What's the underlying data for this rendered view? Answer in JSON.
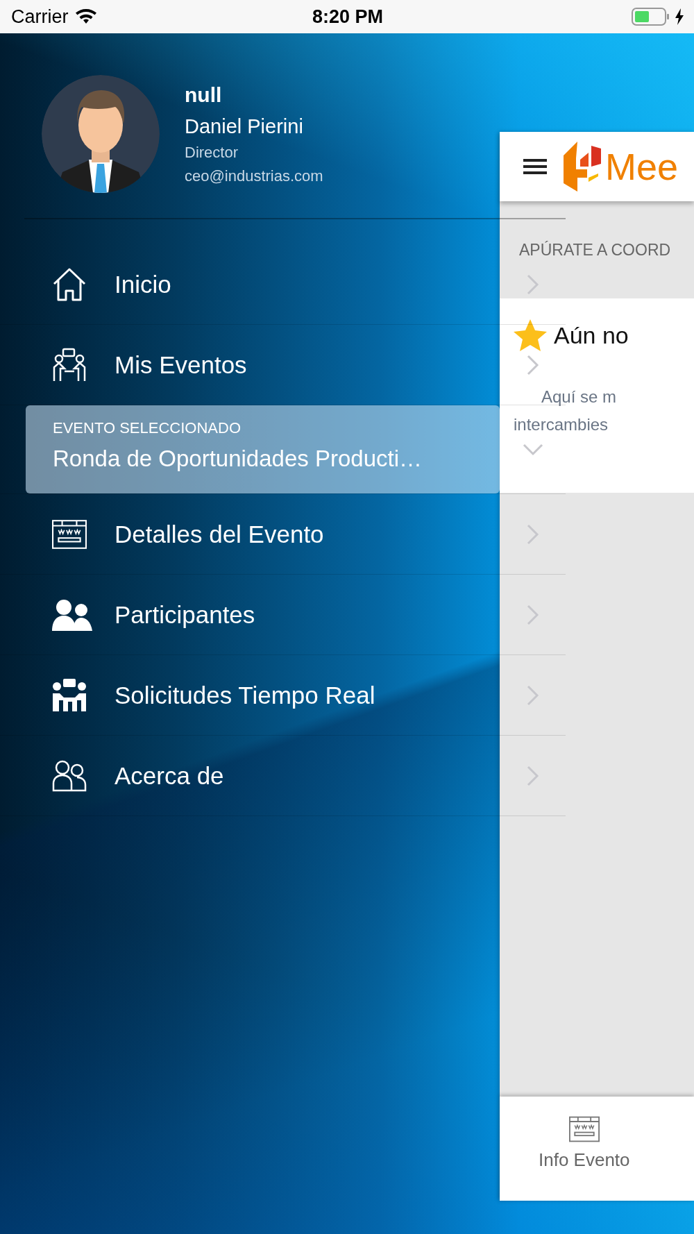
{
  "status_bar": {
    "carrier": "Carrier",
    "time": "8:20 PM"
  },
  "profile": {
    "username": "null",
    "name": "Daniel Pierini",
    "role": "Director",
    "email": "ceo@industrias.com"
  },
  "menu": {
    "items": [
      {
        "kind": "link",
        "label": "Inicio",
        "selected": false
      },
      {
        "kind": "link",
        "label": "Mis Eventos",
        "selected": false
      },
      {
        "kind": "event",
        "caption": "EVENTO SELECCIONADO",
        "label": "Ronda de Oportunidades Producti…",
        "selected": true
      },
      {
        "kind": "link",
        "label": "Detalles del Evento",
        "selected": false
      },
      {
        "kind": "link",
        "label": "Participantes",
        "selected": false
      },
      {
        "kind": "link",
        "label": "Solicitudes Tiempo Real",
        "selected": false
      },
      {
        "kind": "link",
        "label": "Acerca de",
        "selected": false
      }
    ]
  },
  "background_app": {
    "logo_text": "Mee",
    "section_title": "APÚRATE A COORD",
    "card_title": "Aún no",
    "card_text": [
      "Aquí se m",
      "intercambies"
    ],
    "tab_label": "Info Evento"
  }
}
